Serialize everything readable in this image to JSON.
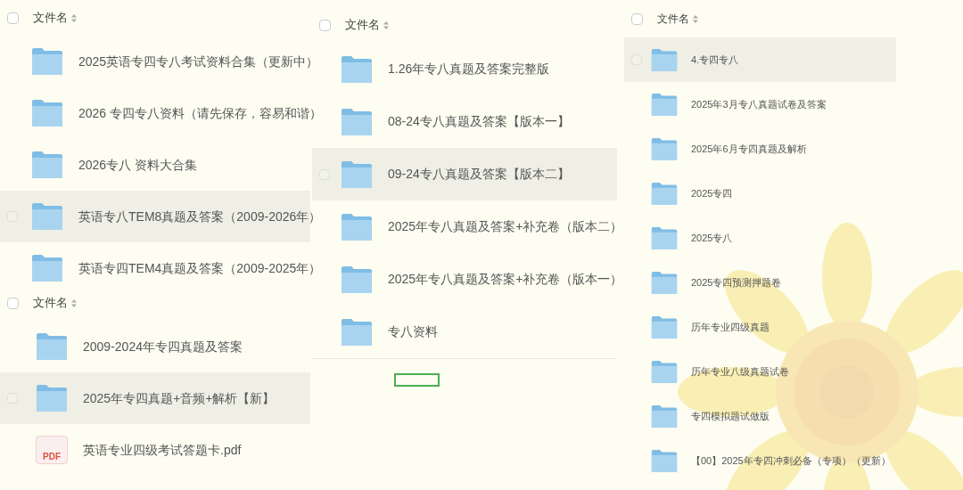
{
  "panels": [
    {
      "header": {
        "label": "文件名",
        "checked": false
      },
      "rows": [
        {
          "name": "2025英语专四专八考试资料合集（更新中）",
          "kind": "folder",
          "selected": false
        },
        {
          "name": "2026 专四专八资料（请先保存，容易和谐）",
          "kind": "folder",
          "selected": false
        },
        {
          "name": "2026专八 资料大合集",
          "kind": "folder",
          "selected": false
        },
        {
          "name": "英语专八TEM8真题及答案（2009-2026年）",
          "kind": "folder",
          "selected": true
        },
        {
          "name": "英语专四TEM4真题及答案（2009-2025年）",
          "kind": "folder",
          "selected": false
        }
      ]
    },
    {
      "header": {
        "label": "文件名",
        "checked": false
      },
      "rows": [
        {
          "name": "1.26年专八真题及答案完整版",
          "kind": "folder",
          "selected": false
        },
        {
          "name": "08-24专八真题及答案【版本一】",
          "kind": "folder",
          "selected": false
        },
        {
          "name": "09-24专八真题及答案【版本二】",
          "kind": "folder",
          "selected": true
        },
        {
          "name": "2025年专八真题及答案+补充卷（版本二）",
          "kind": "folder",
          "selected": false
        },
        {
          "name": "2025年专八真题及答案+补充卷（版本一）",
          "kind": "folder",
          "selected": false
        },
        {
          "name": "专八资料",
          "kind": "folder",
          "selected": false
        }
      ]
    },
    {
      "header": {
        "label": "文件名",
        "checked": false
      },
      "rows": [
        {
          "name": "4.专四专八",
          "kind": "folder",
          "selected": true
        },
        {
          "name": "2025年3月专八真题试卷及答案",
          "kind": "folder",
          "selected": false
        },
        {
          "name": "2025年6月专四真题及解析",
          "kind": "folder",
          "selected": false
        },
        {
          "name": "2025专四",
          "kind": "folder",
          "selected": false
        },
        {
          "name": "2025专八",
          "kind": "folder",
          "selected": false
        },
        {
          "name": "2025专四预测押题卷",
          "kind": "folder",
          "selected": false
        },
        {
          "name": "历年专业四级真题",
          "kind": "folder",
          "selected": false
        },
        {
          "name": "历年专业八级真题试卷",
          "kind": "folder",
          "selected": false
        },
        {
          "name": "专四模拟题试做版",
          "kind": "folder",
          "selected": false
        },
        {
          "name": "【00】2025年专四冲刺必备（专项）（更新）",
          "kind": "folder",
          "selected": false
        }
      ]
    },
    {
      "header": {
        "label": "文件名",
        "checked": false
      },
      "rows": [
        {
          "name": "2009-2024年专四真题及答案",
          "kind": "folder",
          "selected": false
        },
        {
          "name": "2025年专四真题+音频+解析【新】",
          "kind": "folder",
          "selected": true
        },
        {
          "name": "英语专业四级考试答题卡.pdf",
          "kind": "pdf",
          "selected": false
        }
      ]
    }
  ],
  "pdf_badge": "PDF"
}
